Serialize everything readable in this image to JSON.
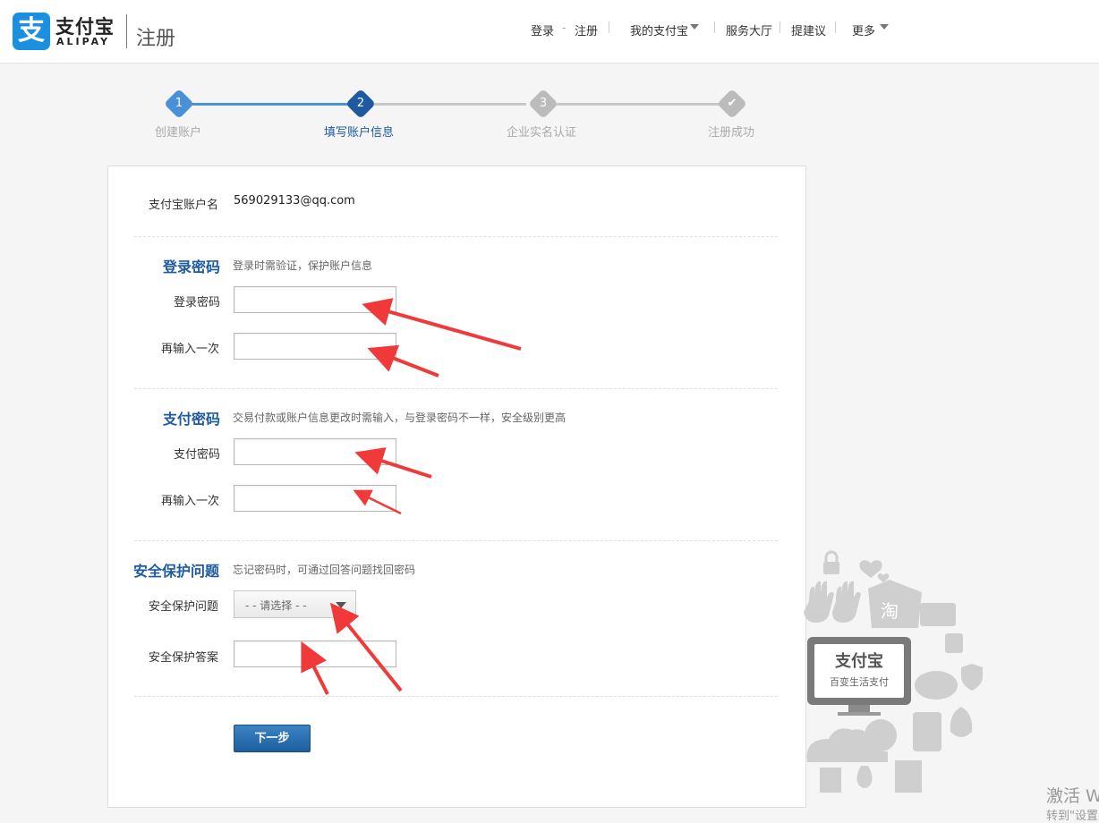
{
  "header": {
    "logo_char": "支",
    "logo_cn": "支付宝",
    "logo_en": "ALIPAY",
    "page_title": "注册",
    "nav": {
      "login": "登录",
      "dash": "-",
      "register": "注册",
      "my_alipay": "我的支付宝",
      "service_hall": "服务大厅",
      "suggest": "提建议",
      "more": "更多"
    }
  },
  "steps": [
    {
      "num": "1",
      "label": "创建账户",
      "state": "done"
    },
    {
      "num": "2",
      "label": "填写账户信息",
      "state": "current"
    },
    {
      "num": "3",
      "label": "企业实名认证",
      "state": "todo"
    },
    {
      "num": "✔",
      "label": "注册成功",
      "state": "todo"
    }
  ],
  "form": {
    "account_label": "支付宝账户名",
    "account_value": "569029133@qq.com",
    "login_section": {
      "title": "登录密码",
      "desc": "登录时需验证，保护账户信息",
      "password_label": "登录密码",
      "confirm_label": "再输入一次"
    },
    "pay_section": {
      "title": "支付密码",
      "desc": "交易付款或账户信息更改时需输入，与登录密码不一样，安全级别更高",
      "password_label": "支付密码",
      "confirm_label": "再输入一次"
    },
    "security_section": {
      "title": "安全保护问题",
      "desc": "忘记密码时，可通过回答问题找回密码",
      "question_label": "安全保护问题",
      "question_selected": "- - 请选择 - -",
      "answer_label": "安全保护答案"
    },
    "next_button": "下一步"
  },
  "illustration": {
    "logo_text": "支付宝",
    "slogan": "百变生活支付",
    "tao_char": "淘"
  },
  "os_watermark": {
    "line1": "激活 W",
    "line2": "转到\"设置"
  },
  "colors": {
    "accent_blue": "#1b8fe0",
    "step_done": "#4a90d9",
    "step_current": "#1d5aa0",
    "step_todo": "#bbbbbb",
    "section_title": "#1d5aa0",
    "annotation_arrow": "#f03a3a"
  }
}
